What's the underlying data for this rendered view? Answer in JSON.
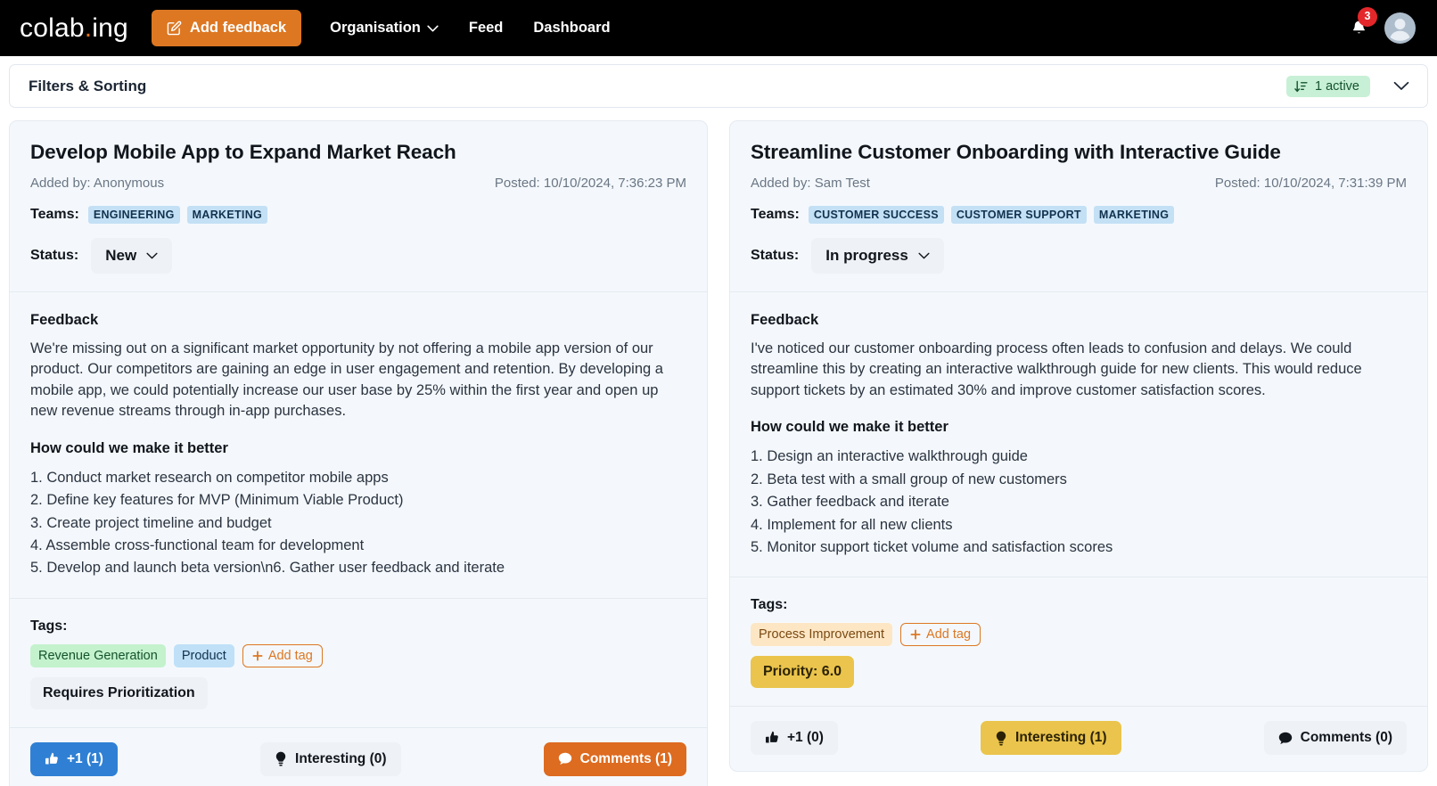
{
  "navbar": {
    "brand_text": "colab",
    "brand_dot": ".",
    "brand_suffix": "ing",
    "add_feedback_label": "Add feedback",
    "links": [
      {
        "label": "Organisation",
        "has_chevron": true
      },
      {
        "label": "Feed",
        "has_chevron": false
      },
      {
        "label": "Dashboard",
        "has_chevron": false
      }
    ],
    "notification_count": "3",
    "accent_color": "#dd7722",
    "background_color": "#000000"
  },
  "filters": {
    "title": "Filters & Sorting",
    "active_pill_label": "1 active",
    "active_pill_color": "#c8f0d6"
  },
  "cards": [
    {
      "title": "Develop Mobile App to Expand Market Reach",
      "added_by": "Added by: Anonymous",
      "posted": "Posted: 10/10/2024, 7:36:23 PM",
      "teams_label": "Teams:",
      "teams": [
        "ENGINEERING",
        "MARKETING"
      ],
      "status_label": "Status:",
      "status_value": "New",
      "feedback_heading": "Feedback",
      "feedback_body": "We're missing out on a significant market opportunity by not offering a mobile app version of our product. Our competitors are gaining an edge in user engagement and retention. By developing a mobile app, we could potentially increase our user base by 25% within the first year and open up new revenue streams through in-app purchases.",
      "improve_heading": "How could we make it better",
      "improvements": [
        "1. Conduct market research on competitor mobile apps",
        "2. Define key features for MVP (Minimum Viable Product)",
        "3. Create project timeline and budget",
        "4. Assemble cross-functional team for development",
        "5. Develop and launch beta version\\n6. Gather user feedback and iterate"
      ],
      "tags_label": "Tags:",
      "tags": [
        {
          "label": "Revenue Generation",
          "style": "tag-green"
        },
        {
          "label": "Product",
          "style": "tag-blue"
        }
      ],
      "add_tag_label": "Add tag",
      "extra_badge": "Requires Prioritization",
      "extra_badge_style": "req-prio",
      "actions": {
        "plus_one": "+1 (1)",
        "plus_one_style": "act-blue",
        "interesting": "Interesting (0)",
        "interesting_style": "act-grey",
        "comments": "Comments (1)",
        "comments_style": "act-orange"
      }
    },
    {
      "title": "Streamline Customer Onboarding with Interactive Guide",
      "added_by": "Added by: Sam Test",
      "posted": "Posted: 10/10/2024, 7:31:39 PM",
      "teams_label": "Teams:",
      "teams": [
        "CUSTOMER SUCCESS",
        "CUSTOMER SUPPORT",
        "MARKETING"
      ],
      "status_label": "Status:",
      "status_value": "In progress",
      "feedback_heading": "Feedback",
      "feedback_body": "I've noticed our customer onboarding process often leads to confusion and delays. We could streamline this by creating an interactive walkthrough guide for new clients. This would reduce support tickets by an estimated 30% and improve customer satisfaction scores.",
      "improve_heading": "How could we make it better",
      "improvements": [
        "1. Design an interactive walkthrough guide",
        "2. Beta test with a small group of new customers",
        "3. Gather feedback and iterate",
        "4. Implement for all new clients",
        "5. Monitor support ticket volume and satisfaction scores"
      ],
      "tags_label": "Tags:",
      "tags": [
        {
          "label": "Process Improvement",
          "style": "tag-peach"
        }
      ],
      "add_tag_label": "Add tag",
      "extra_badge": "Priority: 6.0",
      "extra_badge_style": "priority-badge",
      "actions": {
        "plus_one": "+1 (0)",
        "plus_one_style": "act-grey",
        "interesting": "Interesting (1)",
        "interesting_style": "act-yellow",
        "comments": "Comments (0)",
        "comments_style": "act-grey"
      }
    }
  ]
}
